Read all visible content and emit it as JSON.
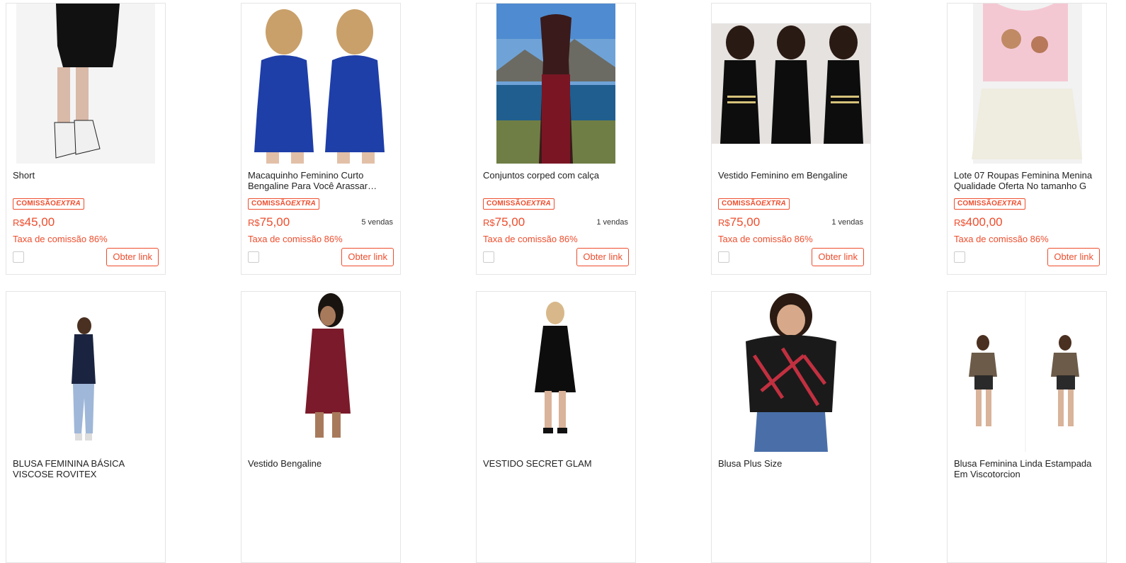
{
  "products": [
    {
      "title": "Short",
      "badge_prefix": "COMISSÃO",
      "badge_extra": "EXTRA",
      "currency": "R$",
      "price": "45,00",
      "sales": "",
      "commission": "Taxa de comissão 86%",
      "button": "Obter link"
    },
    {
      "title": "Macaquinho Feminino Curto Bengaline Para Você Arassar Maquinho Curto Bengaline",
      "badge_prefix": "COMISSÃO",
      "badge_extra": "EXTRA",
      "currency": "R$",
      "price": "75,00",
      "sales": "5 vendas",
      "commission": "Taxa de comissão 86%",
      "button": "Obter link"
    },
    {
      "title": "Conjuntos corped com calça",
      "badge_prefix": "COMISSÃO",
      "badge_extra": "EXTRA",
      "currency": "R$",
      "price": "75,00",
      "sales": "1 vendas",
      "commission": "Taxa de comissão 86%",
      "button": "Obter link"
    },
    {
      "title": "Vestido Feminino em Bengaline",
      "badge_prefix": "COMISSÃO",
      "badge_extra": "EXTRA",
      "currency": "R$",
      "price": "75,00",
      "sales": "1 vendas",
      "commission": "Taxa de comissão 86%",
      "button": "Obter link"
    },
    {
      "title": "Lote 07 Roupas Feminina Menina Qualidade Oferta No tamanho G",
      "badge_prefix": "COMISSÃO",
      "badge_extra": "EXTRA",
      "currency": "R$",
      "price": "400,00",
      "sales": "",
      "commission": "Taxa de comissão 86%",
      "button": "Obter link"
    },
    {
      "title": "BLUSA FEMININA BÁSICA VISCOSE ROVITEX"
    },
    {
      "title": "Vestido Bengaline"
    },
    {
      "title": "VESTIDO SECRET GLAM"
    },
    {
      "title": "Blusa Plus Size"
    },
    {
      "title": "Blusa Feminina Linda Estampada Em Viscotorcion"
    }
  ]
}
